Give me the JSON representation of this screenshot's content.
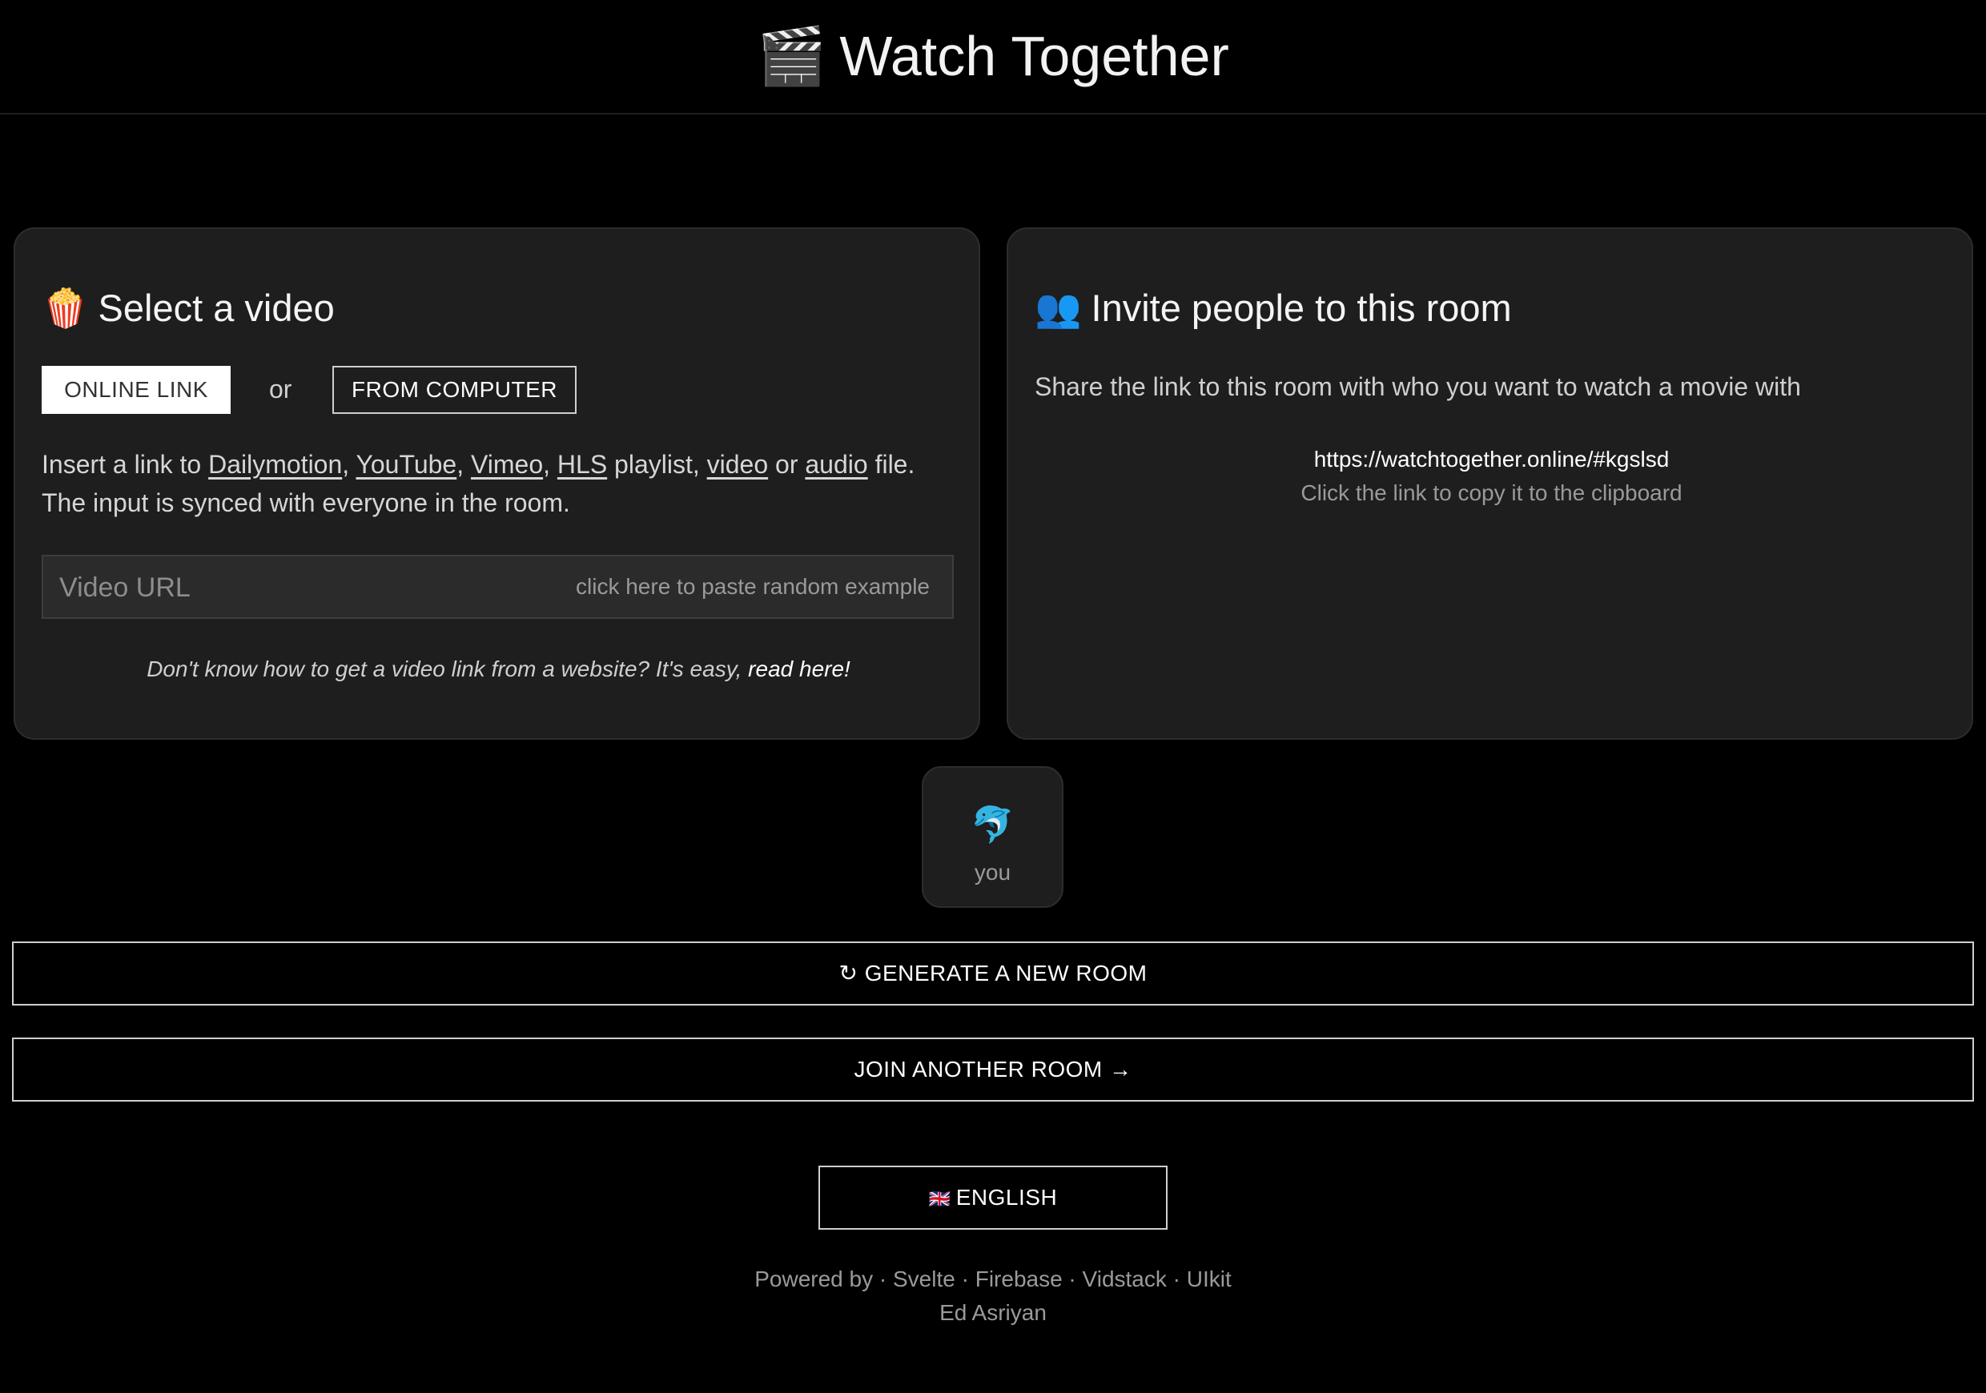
{
  "header": {
    "icon": "clapper-board-icon",
    "icon_glyph": "🎬",
    "title": "Watch Together"
  },
  "select_video": {
    "icon": "popcorn-icon",
    "icon_glyph": "🍿",
    "title": "Select a video",
    "tab_online": "ONLINE LINK",
    "or_text": "or",
    "tab_computer": "FROM COMPUTER",
    "instructions": {
      "prefix": "Insert a link to ",
      "links": [
        "Dailymotion",
        "YouTube",
        "Vimeo",
        "HLS",
        "video",
        "audio"
      ],
      "sep": ", ",
      "playlist": " playlist, ",
      "or": " or ",
      "file": " file.",
      "line2": "The input is synced with everyone in the room."
    },
    "url_input": {
      "placeholder": "Video URL",
      "value": ""
    },
    "paste_example": "click here to paste random example",
    "help": {
      "text": "Don't know how to get a video link from a website? It's easy, ",
      "link": "read here!"
    }
  },
  "invite": {
    "icon": "people-icon",
    "icon_glyph": "👥",
    "title": "Invite people to this room",
    "share_text": "Share the link to this room with who you want to watch a movie with",
    "room_link": "https://watchtogether.online/#kgslsd",
    "copy_hint": "Click the link to copy it to the clipboard"
  },
  "user": {
    "icon": "dolphin-icon",
    "icon_glyph": "🐬",
    "name": "you"
  },
  "actions": {
    "generate_label": "↻ GENERATE A NEW ROOM",
    "join_label": "JOIN ANOTHER ROOM →"
  },
  "language": {
    "flag_icon": "uk-flag-icon",
    "flag_glyph": "🇬🇧",
    "label": "ENGLISH"
  },
  "footer": {
    "powered_by": "Powered by",
    "sep": " · ",
    "tech": [
      "Svelte",
      "Firebase",
      "Vidstack",
      "UIkit"
    ],
    "author": "Ed Asriyan"
  }
}
